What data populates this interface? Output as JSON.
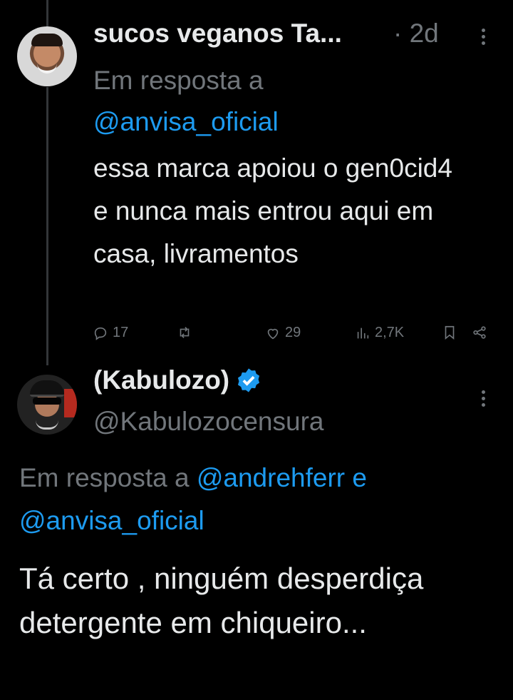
{
  "tweet1": {
    "author_name": "sucos veganos Ta...",
    "separator": "·",
    "time": "2d",
    "reply_prefix": "Em resposta a",
    "reply_mention": "@anvisa_oficial",
    "body": "essa marca apoiou o gen0cid4 e nunca mais entrou aqui em casa, livramentos",
    "stats": {
      "replies": "17",
      "likes": "29",
      "views": "2,7K"
    }
  },
  "tweet2": {
    "author_name": "(Kabulozo)",
    "verified": true,
    "handle": "@Kabulozocensura",
    "reply_prefix": "Em resposta a",
    "reply_mention_1": "@andrehferr",
    "reply_joiner": "e",
    "reply_mention_2": "@anvisa_oficial",
    "body": "Tá certo , ninguém desperdiça detergente em chiqueiro..."
  },
  "colors": {
    "background": "#000000",
    "text": "#e7e9ea",
    "secondary": "#71767b",
    "accent": "#1d9bf0"
  }
}
